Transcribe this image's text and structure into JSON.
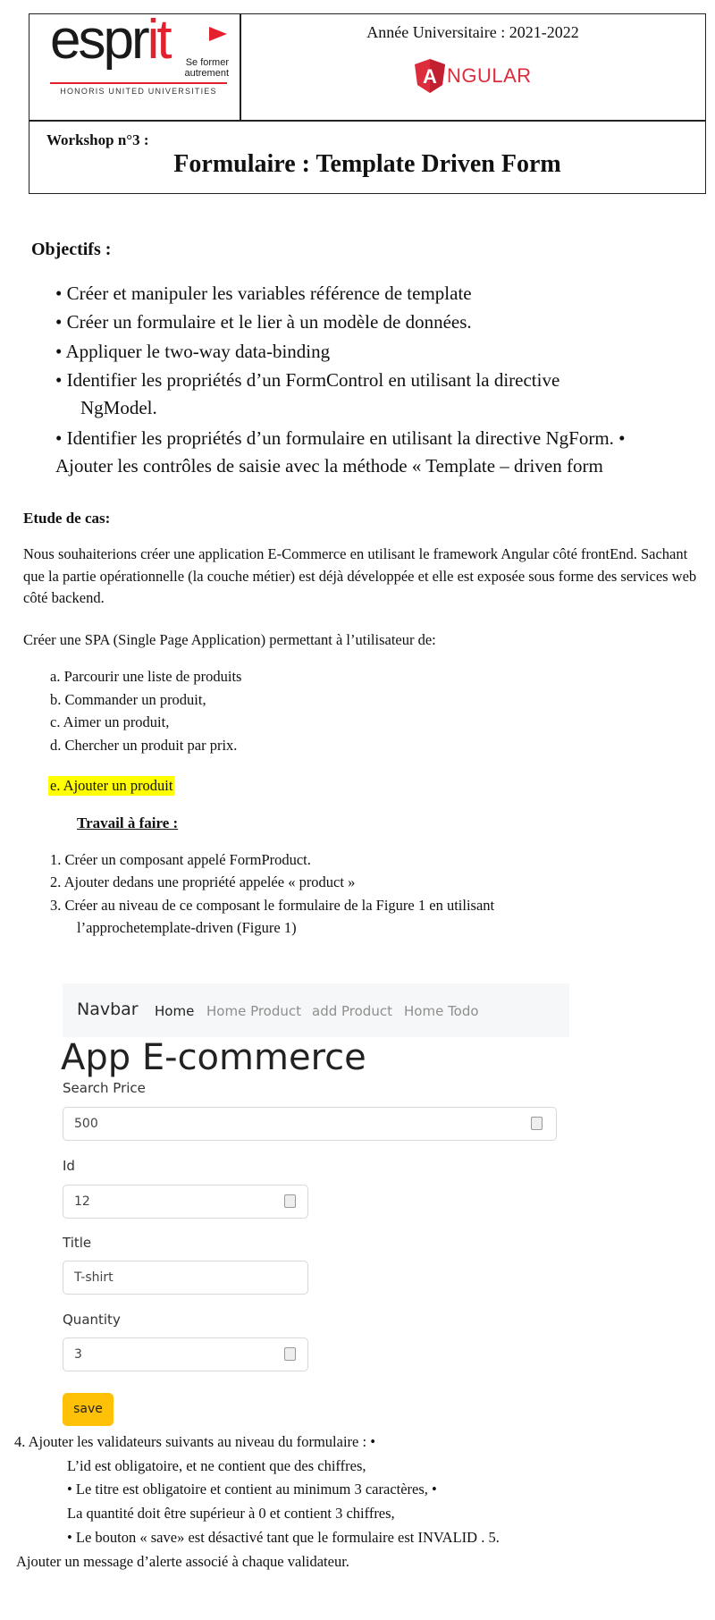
{
  "header": {
    "logo": {
      "brand": "espr",
      "brand_accent": "it",
      "tagline": "Se former autrement",
      "network": "HONORIS UNITED UNIVERSITIES"
    },
    "annee": "Année Universitaire : 2021-2022",
    "angular_logo": {
      "letter": "A",
      "text": "NGULAR"
    },
    "workshop": "Workshop n°3 :",
    "title": "Formulaire : Template Driven Form"
  },
  "objectifs": {
    "heading": "Objectifs :",
    "items": [
      "• Créer et manipuler les variables référence de template",
      "• Créer un formulaire et le lier à un modèle de données.",
      "• Appliquer le two-way data-binding",
      "• Identifier les propriétés d’un FormControl en utilisant la directive",
      "NgModel.",
      "• Identifier les propriétés d’un formulaire en utilisant la directive NgForm. •",
      "Ajouter les contrôles de saisie avec la méthode « Template – driven form"
    ]
  },
  "etude": {
    "heading": "Etude de cas:",
    "paragraph": "Nous souhaiterions créer une application E-Commerce en utilisant le framework Angular côté frontEnd. Sachant que la partie opérationnelle (la couche métier) est déjà développée et elle est exposée sous forme des services web côté backend.",
    "intro": "Créer une SPA (Single Page Application) permettant à l’utilisateur de:",
    "list": [
      "a. Parcourir une liste de produits",
      "b. Commander un produit,",
      "c. Aimer un produit,",
      "d. Chercher un produit par prix."
    ],
    "highlight": "e. Ajouter un produit"
  },
  "travail": {
    "heading": "Travail à faire :",
    "steps": [
      "1. Créer un composant appelé FormProduct.",
      "2. Ajouter dedans une propriété appelée « product »",
      "3. Créer au niveau de ce composant le formulaire de la Figure 1 en utilisant",
      "l’approchetemplate-driven (Figure 1)"
    ]
  },
  "figure": {
    "navbar": {
      "brand": "Navbar",
      "links": [
        "Home",
        "Home Product",
        "add Product",
        "Home Todo"
      ]
    },
    "app_title": "App E-commerce",
    "search_label": "Search Price",
    "search_value": "500",
    "id_label": "Id",
    "id_value": "12",
    "title_label": "Title",
    "title_value": "T-shirt",
    "quantity_label": "Quantity",
    "quantity_value": "3",
    "save_label": "save"
  },
  "validators": [
    "4. Ajouter les validateurs suivants au niveau du formulaire :  •",
    "L’id est obligatoire, et ne contient que des chiffres,",
    "• Le titre est obligatoire et contient au minimum 3 caractères, •",
    "La quantité doit être supérieur à 0 et contient 3 chiffres,",
    "• Le bouton « save» est désactivé tant que le formulaire est INVALID . 5.",
    "Ajouter un message d’alerte associé à chaque validateur."
  ]
}
